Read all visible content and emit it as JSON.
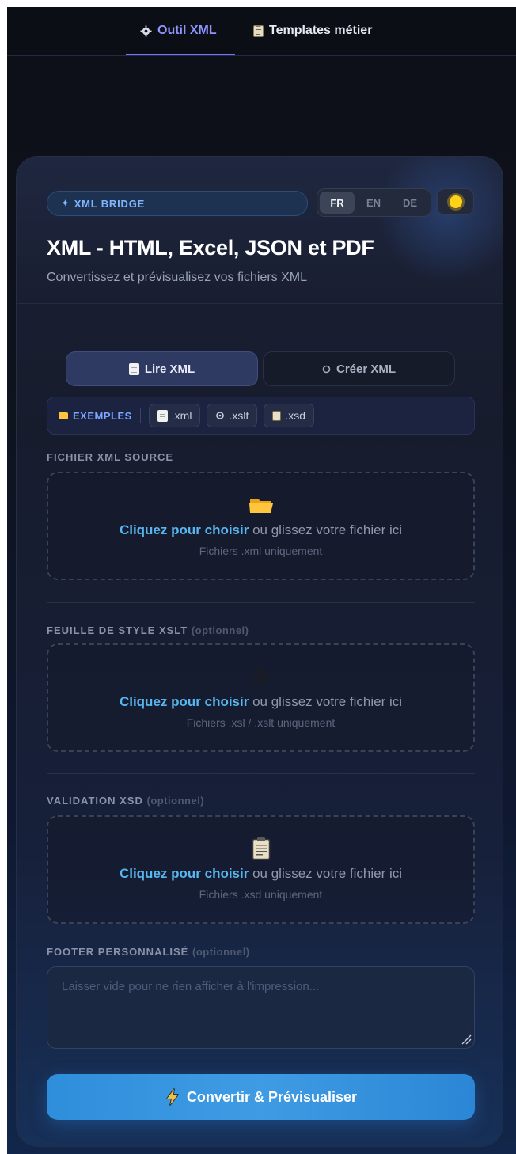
{
  "topnav": {
    "tabs": [
      {
        "icon": "gear-icon",
        "label": "Outil XML",
        "active": true
      },
      {
        "icon": "clipboard-icon",
        "label": "Templates métier",
        "active": false
      }
    ]
  },
  "header": {
    "brand": "XML BRIDGE",
    "languages": [
      {
        "label": "FR",
        "active": true
      },
      {
        "label": "EN",
        "active": false
      },
      {
        "label": "DE",
        "active": false
      }
    ],
    "theme_icon": "sun-icon",
    "title": "XML - HTML, Excel, JSON et PDF",
    "subtitle": "Convertissez et prévisualisez vos fichiers XML"
  },
  "modes": [
    {
      "label": "Lire XML",
      "icon": "document-icon",
      "active": true
    },
    {
      "label": "Créer XML",
      "icon": "circle-icon",
      "active": false
    }
  ],
  "examples": {
    "label": "EXEMPLES",
    "chips": [
      {
        "icon": "document-icon",
        "label": ".xml"
      },
      {
        "icon": "gear-icon",
        "label": ".xslt"
      },
      {
        "icon": "clipboard-icon",
        "label": ".xsd"
      }
    ]
  },
  "sections": {
    "xml_source": {
      "label": "FICHIER XML SOURCE",
      "icon": "folder-icon",
      "link": "Cliquez pour choisir",
      "text": " ou glissez votre fichier ici",
      "hint": "Fichiers .xml uniquement"
    },
    "xslt": {
      "label": "FEUILLE DE STYLE XSLT",
      "optional": "(optionnel)",
      "icon": "gear-icon",
      "link": "Cliquez pour choisir",
      "text": " ou glissez votre fichier ici",
      "hint": "Fichiers .xsl / .xslt uniquement"
    },
    "xsd": {
      "label": "VALIDATION XSD",
      "optional": "(optionnel)",
      "icon": "clipboard-icon",
      "link": "Cliquez pour choisir",
      "text": " ou glissez votre fichier ici",
      "hint": "Fichiers .xsd uniquement"
    },
    "footer": {
      "label": "FOOTER PERSONNALISÉ",
      "optional": "(optionnel)",
      "placeholder": "Laisser vide pour ne rien afficher à l'impression...",
      "value": ""
    }
  },
  "convert": {
    "icon": "lightning-icon",
    "label": "Convertir & Prévisualiser"
  },
  "colors": {
    "accent": "#6f78ff",
    "link": "#57b5f0",
    "button": "#3f9be3",
    "brand": "#7fb4ff"
  }
}
